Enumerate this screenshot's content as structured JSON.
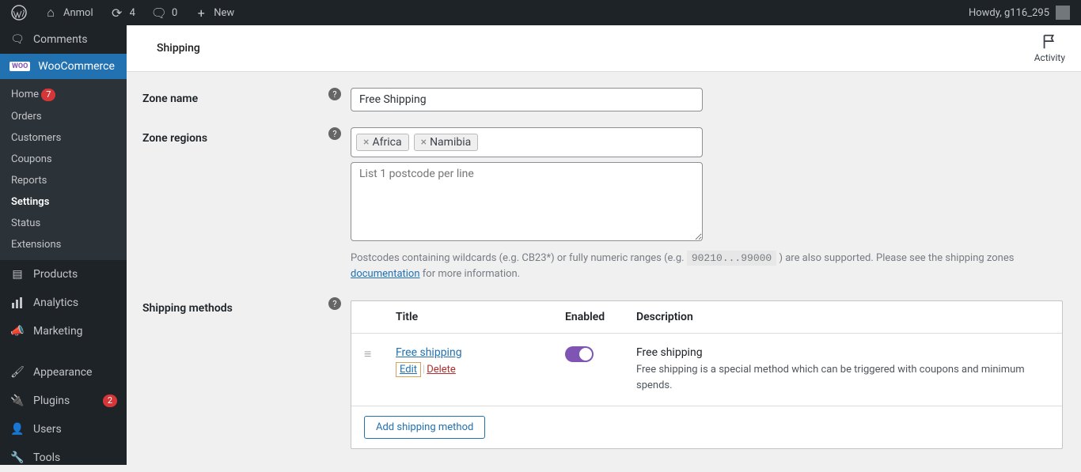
{
  "adminbar": {
    "site_name": "Anmol",
    "updates_count": "4",
    "comments_count": "0",
    "new_label": "New",
    "howdy": "Howdy, g116_295"
  },
  "sidebar": {
    "comments": "Comments",
    "woocommerce": "WooCommerce",
    "woo_tag": "WOO",
    "submenu": {
      "home": "Home",
      "home_badge": "7",
      "orders": "Orders",
      "customers": "Customers",
      "coupons": "Coupons",
      "reports": "Reports",
      "settings": "Settings",
      "status": "Status",
      "extensions": "Extensions"
    },
    "products": "Products",
    "analytics": "Analytics",
    "marketing": "Marketing",
    "appearance": "Appearance",
    "plugins": "Plugins",
    "plugins_badge": "2",
    "users": "Users",
    "tools": "Tools"
  },
  "header": {
    "title": "Shipping",
    "activity": "Activity"
  },
  "form": {
    "zone_name_label": "Zone name",
    "zone_name_value": "Free Shipping",
    "zone_regions_label": "Zone regions",
    "regions": [
      "Africa",
      "Namibia"
    ],
    "postcode_placeholder": "List 1 postcode per line",
    "postcode_help_1": "Postcodes containing wildcards (e.g. CB23*) or fully numeric ranges (e.g. ",
    "postcode_help_code": "90210...99000",
    "postcode_help_2": " ) are also supported. Please see the shipping zones ",
    "postcode_help_link": "documentation",
    "postcode_help_3": " for more information.",
    "shipping_methods_label": "Shipping methods"
  },
  "methods": {
    "head": {
      "title": "Title",
      "enabled": "Enabled",
      "description": "Description"
    },
    "row": {
      "title": "Free shipping",
      "edit": "Edit",
      "delete": "Delete",
      "desc_strong": "Free shipping",
      "desc_text": "Free shipping is a special method which can be triggered with coupons and minimum spends."
    },
    "add_button": "Add shipping method"
  }
}
